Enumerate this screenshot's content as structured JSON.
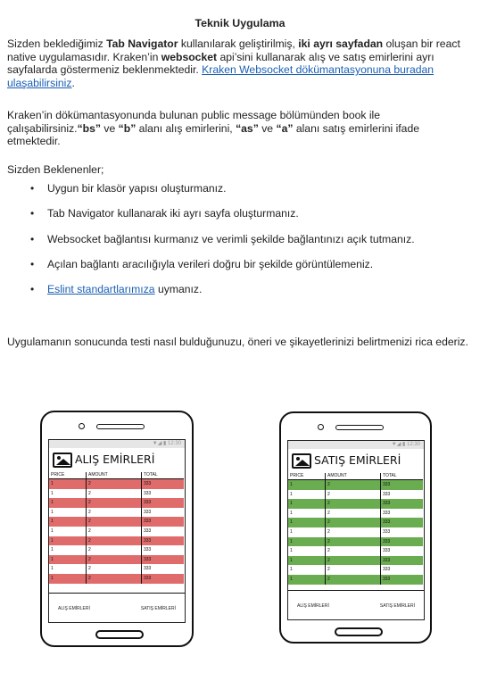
{
  "document": {
    "title": "Teknik Uygulama",
    "p1": {
      "t1": "Sizden beklediğimiz ",
      "b1": "Tab Navigator",
      "t2": " kullanılarak geliştirilmiş, ",
      "b2": "iki ayrı sayfadan",
      "t3": " oluşan bir react native uygulamasıdır. Kraken’in ",
      "b3": "websocket",
      "t4": " api’sini kullanarak  alış ve satış emirlerini ayrı sayfalarda göstermeniz beklenmektedir. ",
      "link": "Kraken Websocket dökümantasyonuna buradan ulaşabilirsiniz",
      "t5": "."
    },
    "p2": {
      "t1": "Kraken’in dökümantasyonunda bulunan public message bölümünden book ile çalışabilirsiniz.",
      "b1": "“bs”",
      "t2": " ve ",
      "b2": "“b”",
      "t3": " alanı alış emirlerini, ",
      "b3": "“as”",
      "t4": " ve ",
      "b4": "“a”",
      "t5": " alanı satış emirlerini ifade etmektedir."
    },
    "p3": "Sizden Beklenenler;",
    "bullets": [
      "Uygun bir klasör yapısı oluşturmanız.",
      "Tab Navigator kullanarak iki ayrı sayfa oluşturmanız.",
      "Websocket bağlantısı kurmanız ve verimli şekilde bağlantınızı açık tutmanız.",
      "Açılan bağlantı aracılığıyla verileri doğru bir şekilde görüntülemeniz."
    ],
    "bullet5": {
      "link": "Eslint standartlarımıza",
      "text": " uymanız."
    },
    "bullet_glyph": "•",
    "p4": "Uygulamanın sonucunda testi nasıl bulduğunuzu, öneri ve şikayetlerinizi belirtmenizi rica ederiz."
  },
  "mockups": {
    "columns": [
      "PRICE",
      "AMOUNT",
      "TOTAL"
    ],
    "row": {
      "price": "1",
      "amount": "2",
      "total": "333"
    },
    "status_text": "▼◢ ▮ 12:30",
    "tab_buy": "ALIŞ EMİRLERİ",
    "tab_sell": "SATIŞ EMİRLERİ",
    "buy": {
      "title": "ALIŞ EMİRLERİ",
      "stripe_color": "#e06b6b",
      "rows": 11
    },
    "sell": {
      "title": "SATIŞ EMİRLERİ",
      "stripe_color": "#6aac50",
      "rows": 11
    }
  }
}
